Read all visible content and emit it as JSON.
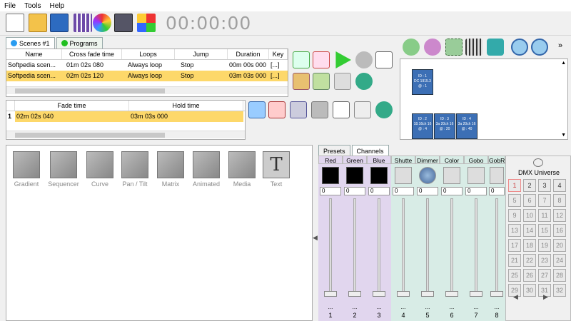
{
  "menu": {
    "file": "File",
    "tools": "Tools",
    "help": "Help"
  },
  "timer": "00:00:00",
  "tabs": {
    "scenes": "Scenes #1",
    "programs": "Programs"
  },
  "scenes_table": {
    "headers": [
      "Name",
      "Cross fade time",
      "Loops",
      "Jump",
      "Duration",
      "Key"
    ],
    "rows": [
      [
        "Softpedia scen...",
        "01m 02s 080",
        "Always loop",
        "Stop",
        "00m 00s 000",
        "[...]"
      ],
      [
        "Softpedia scen...",
        "02m 02s 120",
        "Always loop",
        "Stop",
        "03m 03s 000",
        "[...]"
      ]
    ]
  },
  "steps_table": {
    "headers": [
      "Fade time",
      "Hold time"
    ],
    "rows": [
      [
        "1",
        "02m 02s 040",
        "03m 03s 000"
      ]
    ]
  },
  "fixtures": [
    {
      "id": "ID : 1",
      "info": "DC 1915.3",
      "ch": "@ : 1"
    },
    {
      "id": "ID : 2",
      "info": "18.16ch 16",
      "ch": "@ : 4"
    },
    {
      "id": "ID : 3",
      "info": "3a 20ch 16",
      "ch": "@ : 20"
    },
    {
      "id": "ID : 4",
      "info": "3a 20ch 16",
      "ch": "@ : 40"
    }
  ],
  "effects": [
    "Gradient",
    "Sequencer",
    "Curve",
    "Pan / Tilt",
    "Matrix",
    "Animated",
    "Media",
    "Text"
  ],
  "channel_tabs": {
    "presets": "Presets",
    "channels": "Channels"
  },
  "channels": [
    {
      "name": "Red",
      "value": "0",
      "num": "1"
    },
    {
      "name": "Green",
      "value": "0",
      "num": "2"
    },
    {
      "name": "Blue",
      "value": "0",
      "num": "3"
    },
    {
      "name": "Shutte",
      "value": "0",
      "num": "4"
    },
    {
      "name": "Dimmer",
      "value": "0",
      "num": "5"
    },
    {
      "name": "Color",
      "value": "0",
      "num": "6"
    },
    {
      "name": "Gobo",
      "value": "0",
      "num": "7"
    },
    {
      "name": "GobR",
      "value": "0",
      "num": "8"
    }
  ],
  "channel_dots": "...",
  "dmx": {
    "title": "DMX Universe",
    "cells": [
      "1",
      "2",
      "3",
      "4",
      "5",
      "6",
      "7",
      "8",
      "9",
      "10",
      "11",
      "12",
      "13",
      "14",
      "15",
      "16",
      "17",
      "18",
      "19",
      "20",
      "21",
      "22",
      "23",
      "24",
      "25",
      "26",
      "27",
      "28",
      "29",
      "30",
      "31",
      "32"
    ]
  },
  "colors": {
    "channel_rgb": "#e1d6ee",
    "channel_other": "#d8ece6",
    "selected_row": "#fdd86a",
    "header_band": "#dcdcf0"
  }
}
